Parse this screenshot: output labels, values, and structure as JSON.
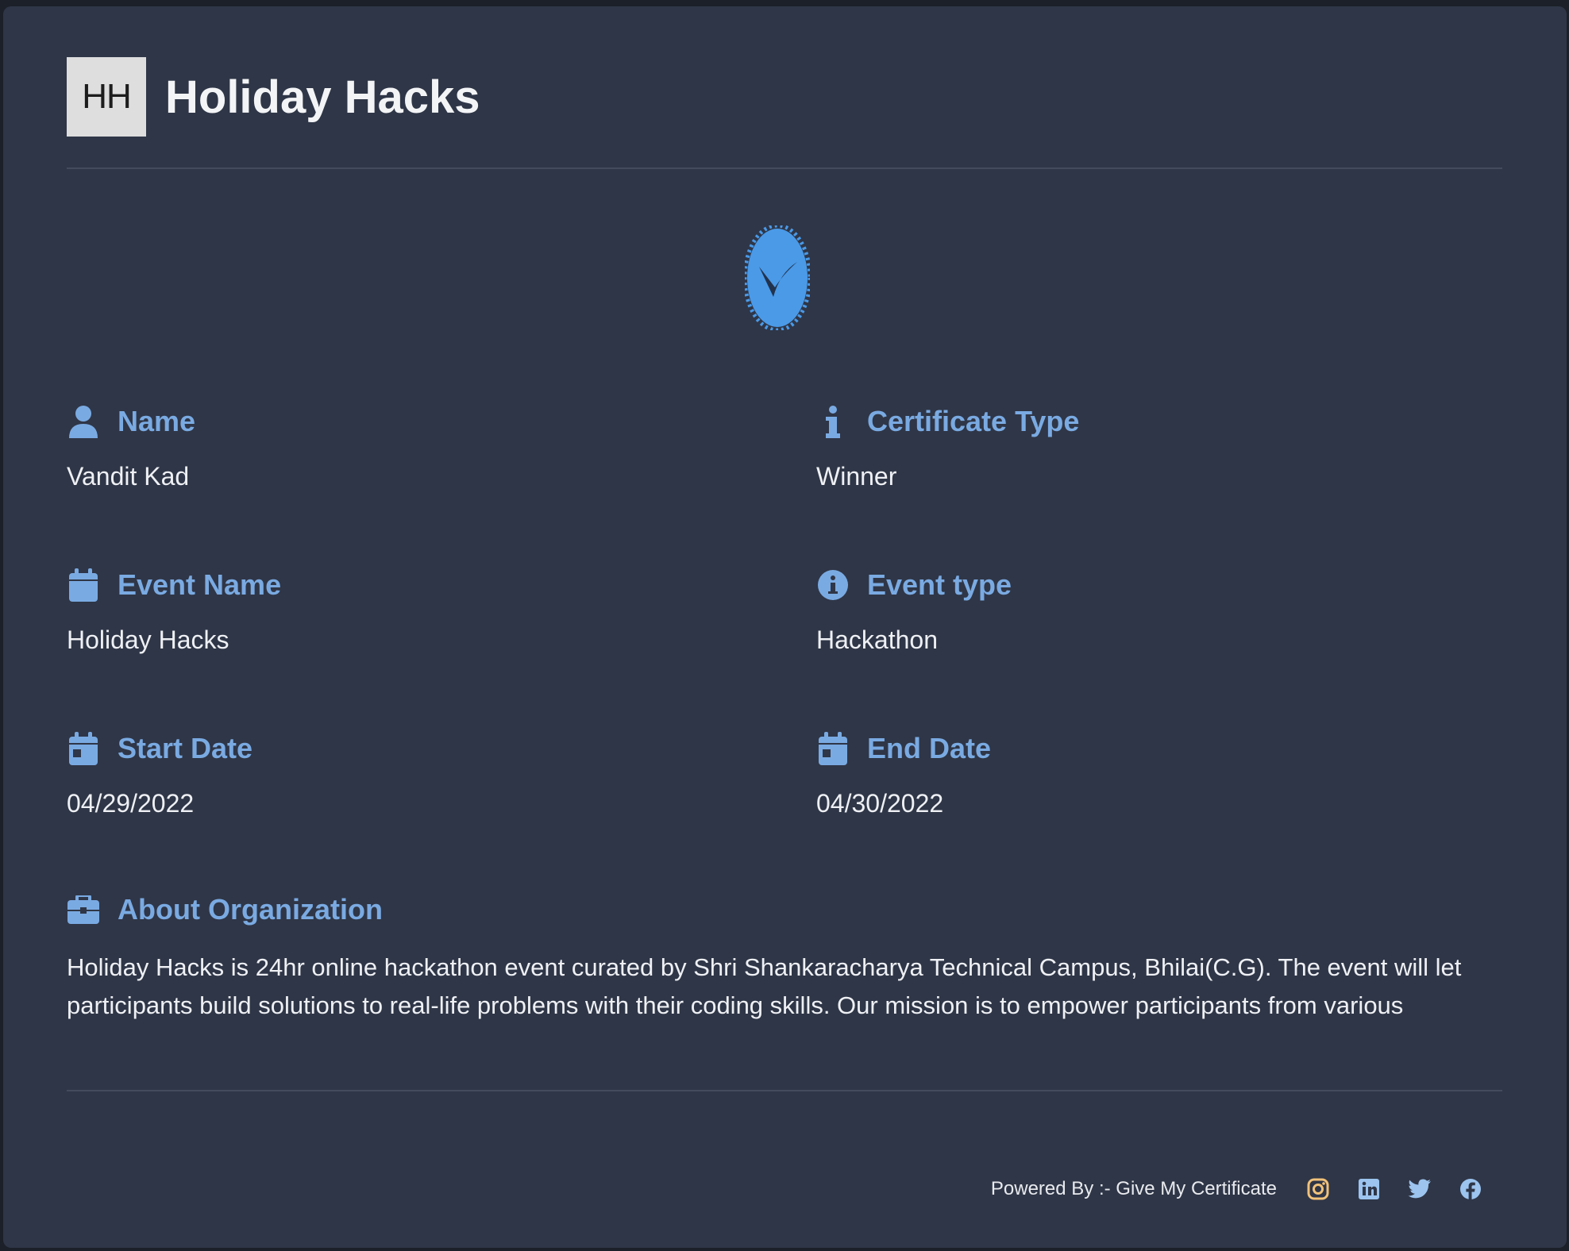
{
  "header": {
    "logo_text": "HH",
    "title": "Holiday Hacks"
  },
  "badge": {
    "icon": "verified-badge-icon",
    "color": "#4a9ae8"
  },
  "fields": {
    "name": {
      "label": "Name",
      "value": "Vandit Kad",
      "icon": "user-icon"
    },
    "certificate_type": {
      "label": "Certificate Type",
      "value": "Winner",
      "icon": "info-icon"
    },
    "event_name": {
      "label": "Event Name",
      "value": "Holiday Hacks",
      "icon": "calendar-icon"
    },
    "event_type": {
      "label": "Event type",
      "value": "Hackathon",
      "icon": "info-circle-icon"
    },
    "start_date": {
      "label": "Start Date",
      "value": "04/29/2022",
      "icon": "calendar-day-icon"
    },
    "end_date": {
      "label": "End Date",
      "value": "04/30/2022",
      "icon": "calendar-day-icon"
    },
    "about": {
      "label": "About Organization",
      "value": "Holiday Hacks is 24hr online hackathon event curated by Shri Shankaracharya Technical Campus, Bhilai(C.G). The event will let participants build solutions to real-life problems with their coding skills. Our mission is to empower participants from various",
      "icon": "briefcase-icon"
    }
  },
  "footer": {
    "powered_by": "Powered By :- Give My Certificate",
    "social": [
      "instagram-icon",
      "linkedin-icon",
      "twitter-icon",
      "facebook-icon"
    ]
  },
  "colors": {
    "background": "#2f3647",
    "accent": "#7aaae2",
    "instagram": "#f1c27a",
    "social": "#9cc4ef"
  }
}
